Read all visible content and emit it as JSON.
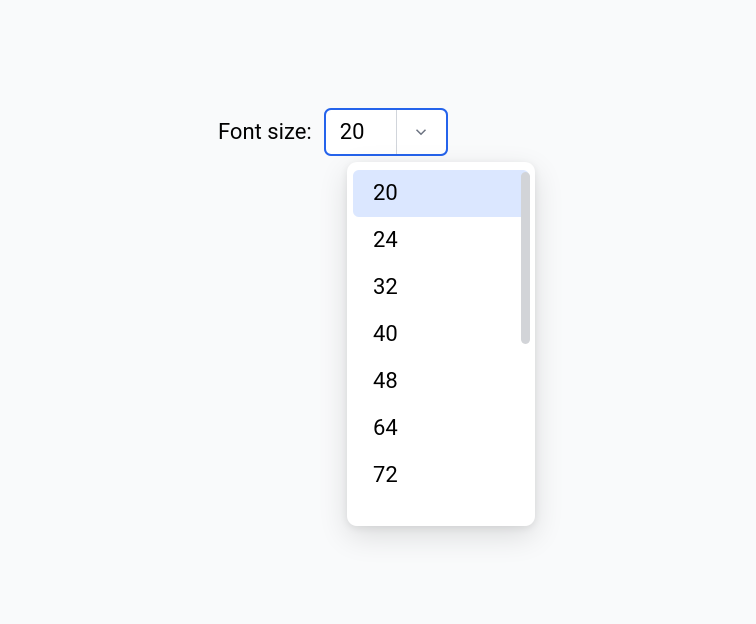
{
  "label": "Font size:",
  "combobox": {
    "value": "20"
  },
  "options": [
    {
      "label": "20",
      "selected": true
    },
    {
      "label": "24",
      "selected": false
    },
    {
      "label": "32",
      "selected": false
    },
    {
      "label": "40",
      "selected": false
    },
    {
      "label": "48",
      "selected": false
    },
    {
      "label": "64",
      "selected": false
    },
    {
      "label": "72",
      "selected": false
    }
  ]
}
